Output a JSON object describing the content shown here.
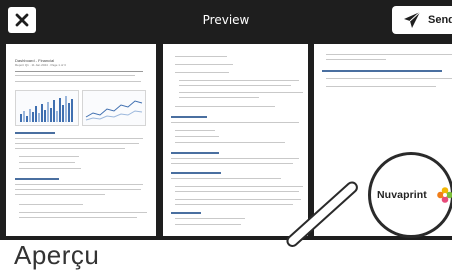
{
  "preview_window": {
    "title": "Preview",
    "send_label": "Send"
  },
  "document": {
    "title": "Dashboard - Financial",
    "subtitle": "Report Q1 · 11 Jan 2024 · Page 1 of 3"
  },
  "brand": {
    "name": "Nuvaprint"
  },
  "caption": "Aperçu",
  "colors": {
    "frame_bg": "#1e1e1e",
    "page_bg": "#ffffff",
    "chart_bar": "#3f6fb0",
    "chart_bar_light": "#9bb7dc",
    "logo_yellow": "#f2b705",
    "logo_orange": "#f07d19",
    "logo_green": "#7cbf3a",
    "logo_pink": "#e84a7a"
  },
  "icons": {
    "close": "close-icon",
    "send": "paper-plane-icon"
  }
}
